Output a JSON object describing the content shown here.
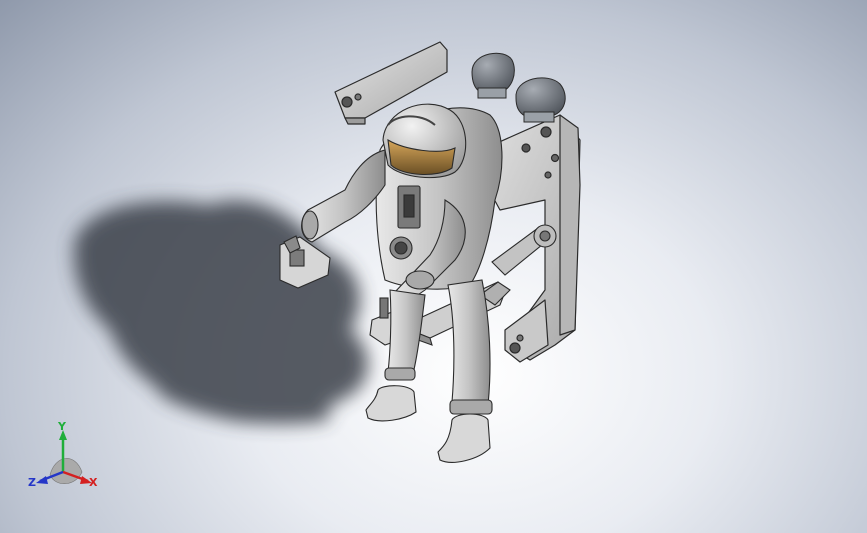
{
  "app": {
    "view": "isometric-3d-model-viewport"
  },
  "model": {
    "subject": "astronaut-with-jetpack"
  },
  "triad": {
    "x_label": "X",
    "y_label": "Y",
    "z_label": "Z",
    "x_color": "#d42020",
    "y_color": "#1fae3a",
    "z_color": "#2436c8"
  },
  "colors": {
    "suit": "#c9c9c9",
    "suit_shade": "#9d9d9d",
    "frame": "#d2d2d2",
    "tank": "#6f747b",
    "visor": "#b0843f",
    "shadow": "#3a3f48"
  }
}
